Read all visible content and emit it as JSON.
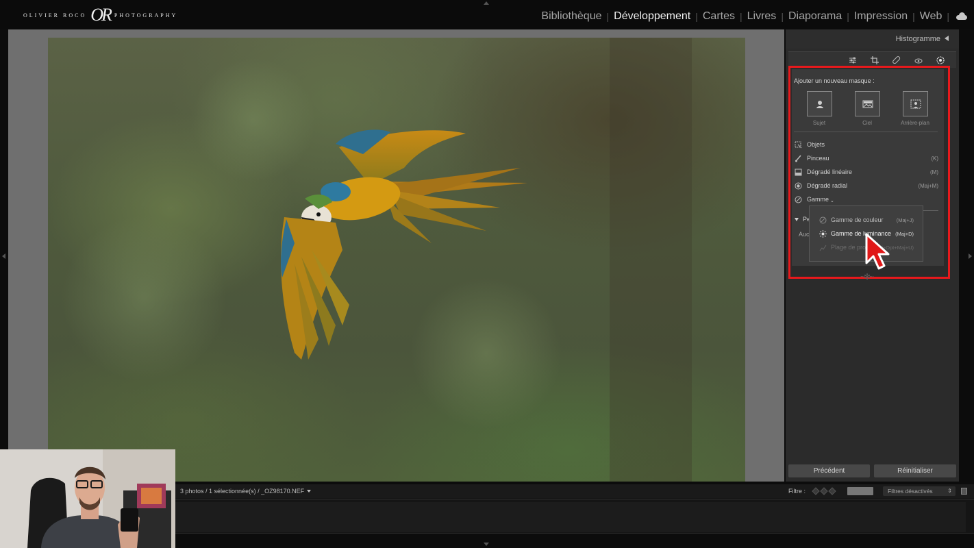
{
  "branding": {
    "logo_left": "OLIVIER ROCO",
    "logo_mark": "OR",
    "logo_right": "PHOTOGRAPHY"
  },
  "modules": [
    {
      "label": "Bibliothèque",
      "active": false
    },
    {
      "label": "Développement",
      "active": true
    },
    {
      "label": "Cartes",
      "active": false
    },
    {
      "label": "Livres",
      "active": false
    },
    {
      "label": "Diaporama",
      "active": false
    },
    {
      "label": "Impression",
      "active": false
    },
    {
      "label": "Web",
      "active": false
    }
  ],
  "right_panel": {
    "histogram_label": "Histogramme",
    "tools": [
      "sliders-icon",
      "crop-icon",
      "healing-icon",
      "redeye-icon",
      "masking-icon"
    ],
    "mask": {
      "title": "Ajouter un nouveau masque :",
      "quick_buttons": [
        {
          "label": "Sujet",
          "icon": "person-icon"
        },
        {
          "label": "Ciel",
          "icon": "sky-icon"
        },
        {
          "label": "Arrière-plan",
          "icon": "background-icon"
        }
      ],
      "items": [
        {
          "label": "Objets",
          "shortcut": "",
          "icon": "objects-icon"
        },
        {
          "label": "Pinceau",
          "shortcut": "(K)",
          "icon": "brush-icon"
        },
        {
          "label": "Dégradé linéaire",
          "shortcut": "(M)",
          "icon": "linear-gradient-icon"
        },
        {
          "label": "Dégradé radial",
          "shortcut": "(Maj+M)",
          "icon": "radial-gradient-icon"
        },
        {
          "label": "Gamme",
          "shortcut": "",
          "icon": "range-icon"
        }
      ],
      "people_section_partial": "Pe",
      "none_partial": "Auc"
    },
    "range_menu": [
      {
        "label": "Gamme de couleur",
        "shortcut": "(Maj+J)",
        "state": "normal"
      },
      {
        "label": "Gamme de luminance",
        "shortcut": "(Maj+D)",
        "state": "hover"
      },
      {
        "label": "Plage de pro",
        "shortcut": "d+Opt+Maj+U)",
        "state": "disabled"
      }
    ],
    "buttons": {
      "previous": "Précédent",
      "reset": "Réinitialiser"
    }
  },
  "filmstrip": {
    "info": "3 photos / 1 sélectionnée(s) / _OZ98170.NEF",
    "filter_label": "Filtre :",
    "filters_select": "Filtres désactivés"
  },
  "colors": {
    "highlight": "#e8191c",
    "panel_bg": "#2b2b2b",
    "viewer_bg": "#6f6f6f"
  }
}
